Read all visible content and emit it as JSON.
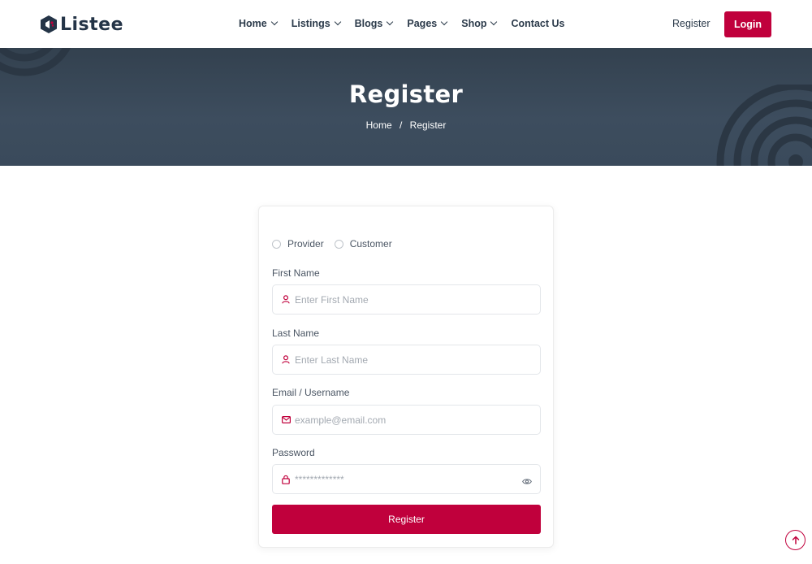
{
  "brand": {
    "name": "Listee",
    "accent": "#c0003c",
    "dark": "#243447"
  },
  "nav": {
    "items": [
      {
        "label": "Home",
        "dropdown": true
      },
      {
        "label": "Listings",
        "dropdown": true
      },
      {
        "label": "Blogs",
        "dropdown": true
      },
      {
        "label": "Pages",
        "dropdown": true
      },
      {
        "label": "Shop",
        "dropdown": true
      },
      {
        "label": "Contact Us",
        "dropdown": false
      }
    ],
    "register_label": "Register",
    "login_label": "Login"
  },
  "banner": {
    "title": "Register",
    "breadcrumb": {
      "home": "Home",
      "separator": "/",
      "current": "Register"
    }
  },
  "form": {
    "roles": [
      {
        "label": "Provider",
        "selected": false
      },
      {
        "label": "Customer",
        "selected": false
      }
    ],
    "first_name": {
      "label": "First Name",
      "placeholder": "Enter First Name",
      "icon": "user-icon"
    },
    "last_name": {
      "label": "Last Name",
      "placeholder": "Enter Last Name",
      "icon": "user-icon"
    },
    "email": {
      "label": "Email / Username",
      "placeholder": "example@email.com",
      "icon": "mail-icon"
    },
    "password": {
      "label": "Password",
      "placeholder": "*************",
      "icon": "lock-icon"
    },
    "submit_label": "Register"
  }
}
